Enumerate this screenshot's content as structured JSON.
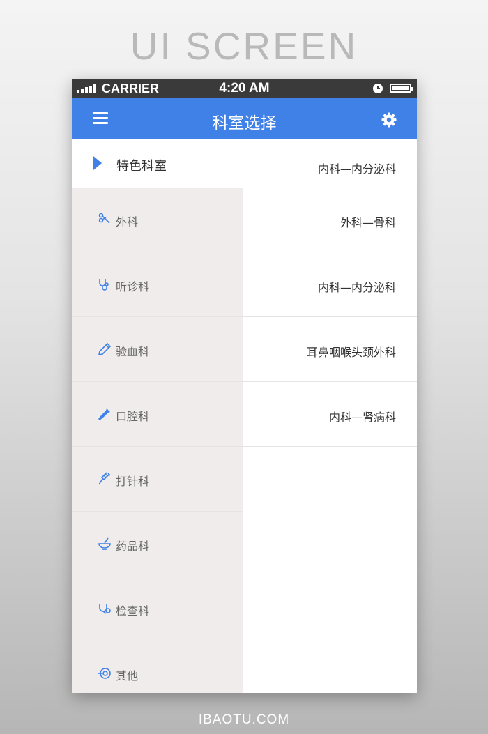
{
  "page": {
    "heading": "UI SCREEN",
    "footer": "IBAOTU.COM"
  },
  "status_bar": {
    "carrier": "CARRIER",
    "time": "4:20 AM"
  },
  "nav": {
    "title": "科室选择",
    "menu_icon": "menu-icon",
    "settings_icon": "gear-icon",
    "accent": "#3f81e6"
  },
  "featured": {
    "label": "特色科室",
    "subtitle": "内科—内分泌科"
  },
  "departments": [
    {
      "label": "外科",
      "icon": "scissors-icon"
    },
    {
      "label": "听诊科",
      "icon": "stethoscope-icon"
    },
    {
      "label": "验血科",
      "icon": "pencil-icon"
    },
    {
      "label": "口腔科",
      "icon": "dropper-icon"
    },
    {
      "label": "打针科",
      "icon": "syringe-icon"
    },
    {
      "label": "药品科",
      "icon": "mortar-icon"
    },
    {
      "label": "检查科",
      "icon": "checkup-icon"
    },
    {
      "label": "其他",
      "icon": "other-icon"
    }
  ],
  "sub_departments": [
    {
      "label": "外科—骨科"
    },
    {
      "label": "内科—内分泌科"
    },
    {
      "label": "耳鼻咽喉头颈外科"
    },
    {
      "label": "内科—肾病科"
    }
  ]
}
